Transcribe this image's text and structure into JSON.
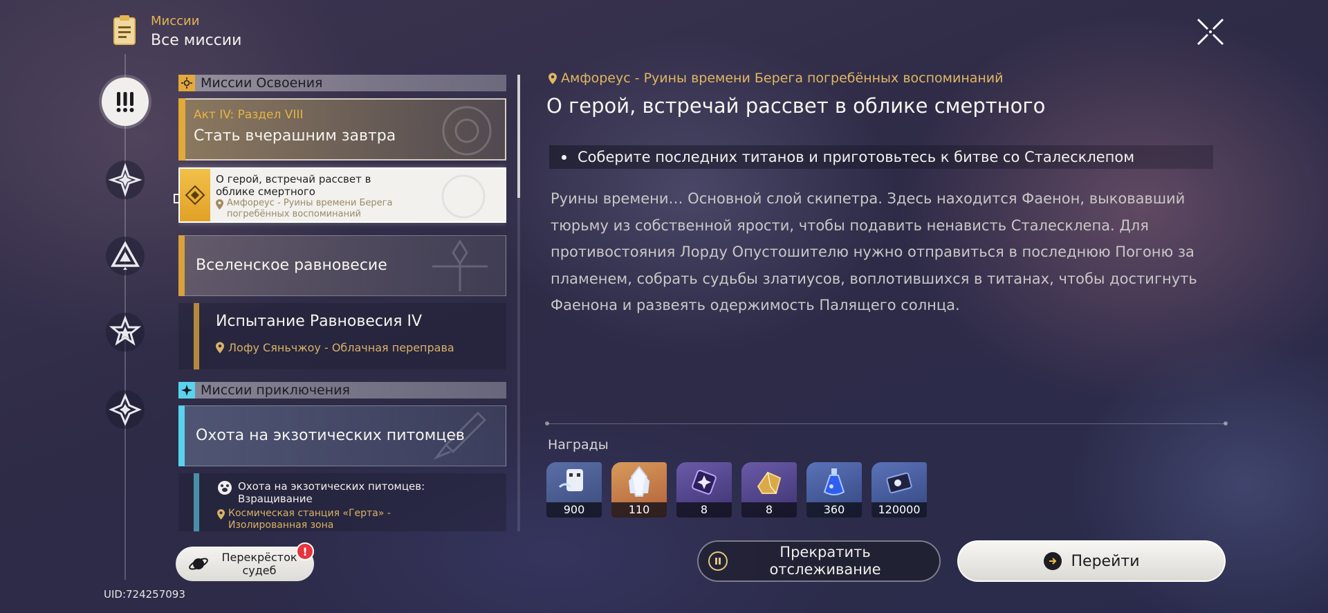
{
  "header": {
    "section": "Миссии",
    "title": "Все миссии"
  },
  "sidebar": {
    "items": [
      {
        "icon": "exclamation-icon",
        "active": true
      },
      {
        "icon": "compass-star-icon",
        "active": false
      },
      {
        "icon": "triangle-icon",
        "active": false
      },
      {
        "icon": "star-icon",
        "active": false
      },
      {
        "icon": "four-point-star-icon",
        "active": false
      }
    ]
  },
  "list": {
    "section1": "Миссии Освоения",
    "card1": {
      "act": "Акт IV: Раздел VIII",
      "title": "Стать вчерашним завтра"
    },
    "card1_sub": {
      "title": "О герой, встречай рассвет в облике смертного",
      "location": "Амфореус - Руины времени Берега погребённых воспоминаний"
    },
    "card2": {
      "title": "Вселенское равновесие"
    },
    "card2_sub": {
      "title": "Испытание Равновесия IV",
      "location": "Лофу Сяньчжоу - Облачная переправа"
    },
    "section2": "Миссии приключения",
    "card3": {
      "title": "Охота на экзотических питомцев"
    },
    "card3_sub": {
      "title": "Охота на экзотических питомцев: Взращивание",
      "location": "Космическая станция «Герта» - Изолированная зона"
    }
  },
  "crossroads": {
    "label": "Перекрёсток судеб",
    "badge": "!"
  },
  "uid": "UID:724257093",
  "detail": {
    "location": "Амфореус - Руины времени Берега погребённых воспоминаний",
    "title": "О герой, встречай рассвет в облике смертного",
    "objective": "Соберите последних титанов и приготовьтесь к битве со Сталесклепом",
    "description": "Руины времени… Основной слой скипетра. Здесь находится Фаенон, выковавший тюрьму из собственной ярости, чтобы подавить ненависть Сталесклепа. Для противостояния Лорду Опустошителю нужно отправиться в последнюю Погоню за пламенем, собрать судьбы златиусов, воплотившихся в титанах, чтобы достигнуть Фаенона и развеять одержимость Палящего солнца.",
    "rewards_label": "Награды",
    "rewards": [
      {
        "icon": "trailblaze-exp-icon",
        "amount": "900"
      },
      {
        "icon": "crystal-icon",
        "amount": "110"
      },
      {
        "icon": "purple-material-icon",
        "amount": "8"
      },
      {
        "icon": "gold-material-icon",
        "amount": "8"
      },
      {
        "icon": "blue-potion-icon",
        "amount": "360"
      },
      {
        "icon": "credit-icon",
        "amount": "120000"
      }
    ],
    "stop_label": "Прекратить отслеживание",
    "go_label": "Перейти"
  },
  "colors": {
    "accent_gold": "#e2b552",
    "accent_cyan": "#5ad3ee",
    "badge_red": "#e8343d"
  }
}
